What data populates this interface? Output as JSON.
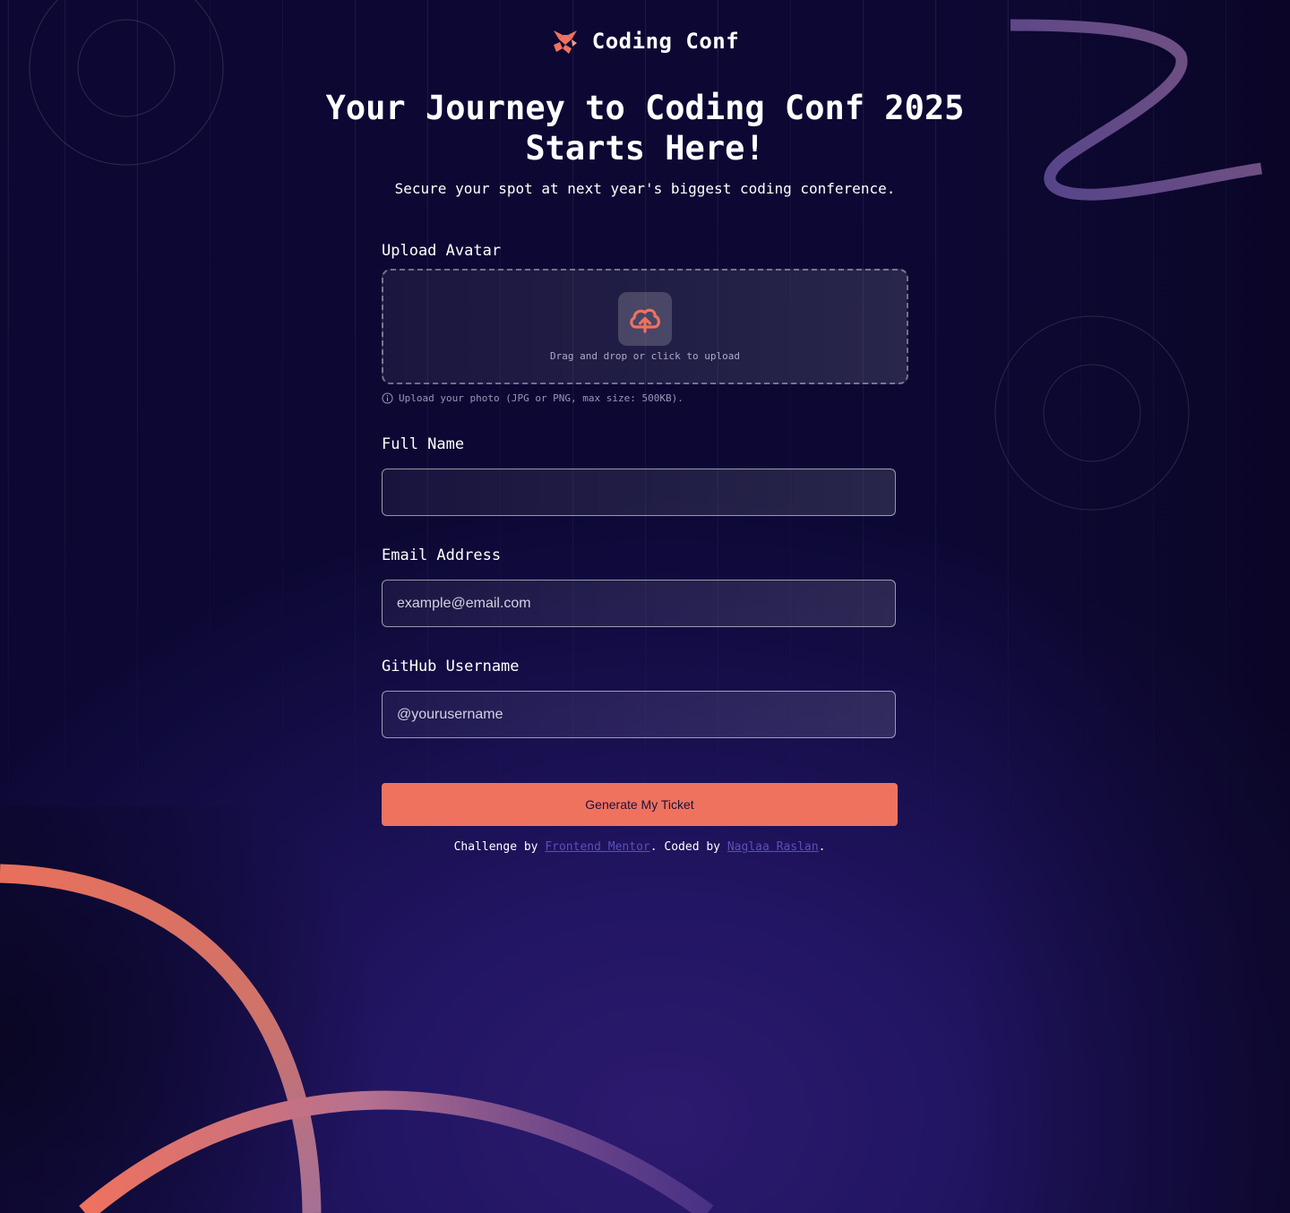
{
  "brand": {
    "name": "Coding Conf",
    "logo_icon": "coding-conf-logo-icon",
    "accent_color": "#ef725f"
  },
  "hero": {
    "title": "Your Journey to Coding Conf 2025 Starts Here!",
    "subtitle": "Secure your spot at next year's biggest coding conference."
  },
  "form": {
    "avatar": {
      "label": "Upload Avatar",
      "dropzone_text": "Drag and drop or click to upload",
      "icon": "upload-cloud-icon",
      "hint": "Upload your photo (JPG or PNG, max size: 500KB)."
    },
    "full_name": {
      "label": "Full Name",
      "placeholder": "",
      "value": ""
    },
    "email": {
      "label": "Email Address",
      "placeholder": "example@email.com",
      "value": ""
    },
    "github": {
      "label": "GitHub Username",
      "placeholder": "@yourusername",
      "value": ""
    },
    "submit_label": "Generate My Ticket"
  },
  "footer": {
    "prefix": "Challenge by",
    "link1": "Frontend Mentor",
    "middle": ". Coded by",
    "link2": "Naglaa Raslan",
    "suffix": "."
  },
  "colors": {
    "background": "#170f4d",
    "button": "#ef725f",
    "link": "#5a4fb8"
  }
}
